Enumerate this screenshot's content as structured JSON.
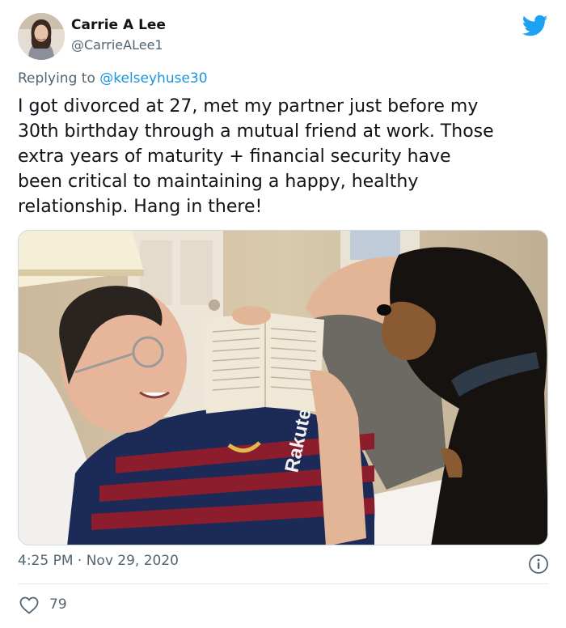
{
  "author": {
    "name": "Carrie A Lee",
    "handle": "@CarrieALee1",
    "avatar_icon": "profile-photo"
  },
  "reply": {
    "prefix": "Replying to ",
    "mention": "@kelseyhuse30"
  },
  "tweet": {
    "lines": [
      "I got divorced at 27, met my partner just before my",
      "30th birthday through a mutual friend at work. Those",
      "extra years of maturity + financial security have",
      "been critical to maintaining a happy, healthy",
      "relationship. Hang in there!"
    ]
  },
  "photo": {
    "jersey_text": "Rakuten"
  },
  "meta": {
    "timestamp": "4:25 PM · Nov 29, 2020",
    "likes": "79"
  },
  "icons": {
    "brand": "twitter-bird-icon",
    "info": "info-icon",
    "like": "heart-icon"
  },
  "colors": {
    "brand": "#1da1f2",
    "mention": "#1b95e0",
    "secondary_text": "#536471",
    "primary_text": "#0f1419"
  }
}
